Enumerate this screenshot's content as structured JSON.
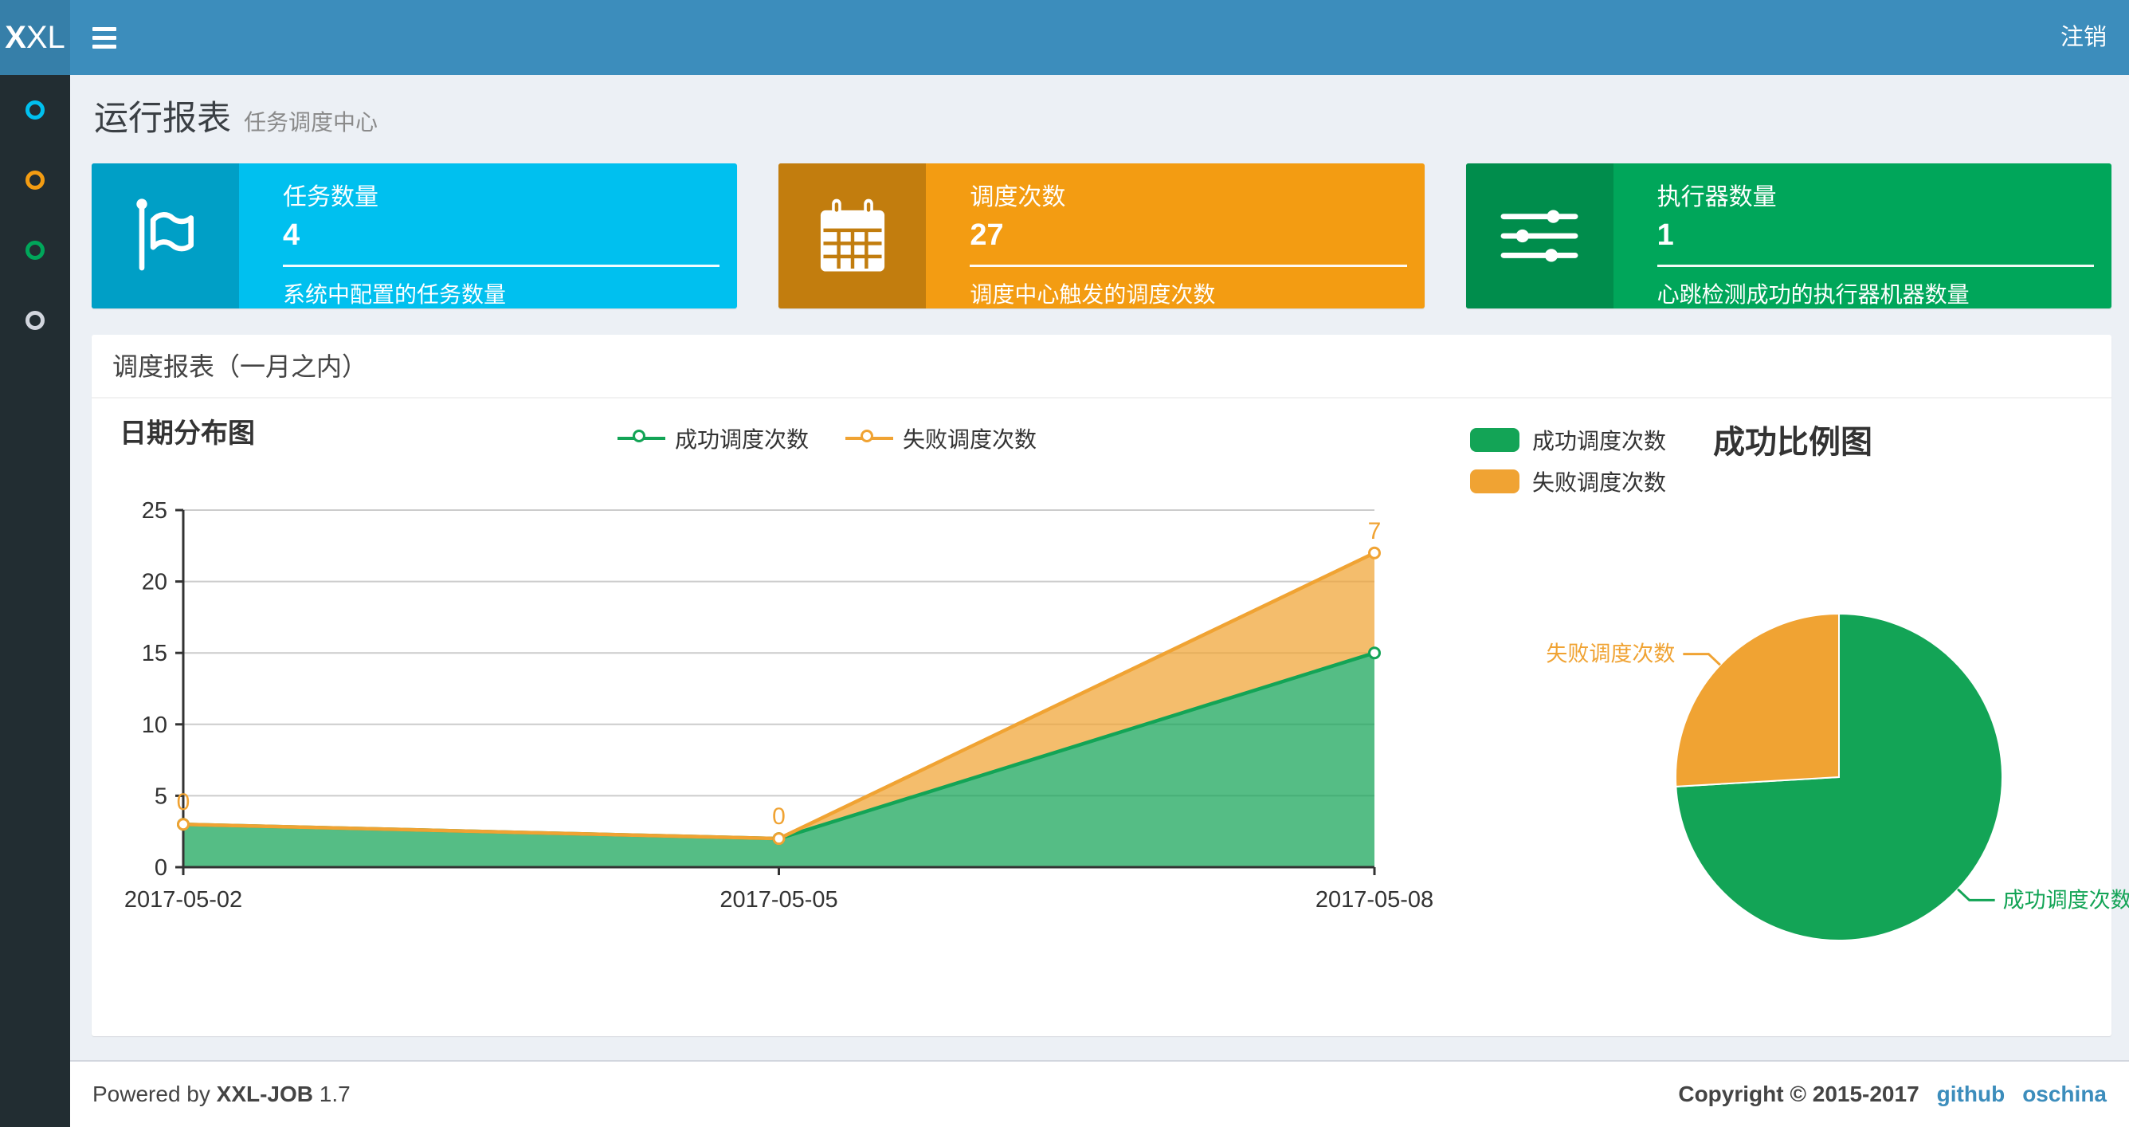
{
  "navbar": {
    "logo_bold": "X",
    "logo_rest": "XL",
    "logout": "注销"
  },
  "sidebar": {
    "items": [
      {
        "name": "menu-dashboard",
        "color": "#00c0ef"
      },
      {
        "name": "menu-jobs",
        "color": "#f39c12"
      },
      {
        "name": "menu-executors",
        "color": "#00a65a"
      },
      {
        "name": "menu-logs",
        "color": "#d2d6de"
      }
    ]
  },
  "page_header": {
    "title": "运行报表",
    "subtitle": "任务调度中心"
  },
  "stat_cards": [
    {
      "title": "任务数量",
      "value": "4",
      "description": "系统中配置的任务数量",
      "color": "#00c0ef",
      "icon_bg": "#009fc6",
      "icon": "flag"
    },
    {
      "title": "调度次数",
      "value": "27",
      "description": "调度中心触发的调度次数",
      "color": "#f39c12",
      "icon_bg": "#c27d0e",
      "icon": "calendar"
    },
    {
      "title": "执行器数量",
      "value": "1",
      "description": "心跳检测成功的执行器机器数量",
      "color": "#00a65a",
      "icon_bg": "#008d4c",
      "icon": "sliders"
    }
  ],
  "panel": {
    "title": "调度报表（一月之内）"
  },
  "chart_data": [
    {
      "type": "area",
      "title": "日期分布图",
      "stacked": true,
      "categories": [
        "2017-05-02",
        "2017-05-05",
        "2017-05-08"
      ],
      "series": [
        {
          "name": "成功调度次数",
          "values": [
            3,
            2,
            15
          ],
          "color": "#13a456"
        },
        {
          "name": "失败调度次数",
          "values": [
            0,
            0,
            7
          ],
          "color": "#f0a333"
        }
      ],
      "data_labels_series": "失败调度次数",
      "data_labels": [
        0,
        0,
        7
      ],
      "ylim": [
        0,
        25
      ],
      "ytick_interval": 5,
      "grid": true,
      "legend_position": "top-center"
    },
    {
      "type": "pie",
      "title": "成功比例图",
      "labels": [
        "成功调度次数",
        "失败调度次数"
      ],
      "values": [
        20,
        7
      ],
      "colors": [
        "#13a456",
        "#f0a333"
      ],
      "start_angle_deg": 90,
      "direction": "clockwise",
      "legend_position": "top-left"
    }
  ],
  "footer": {
    "powered_prefix": "Powered by",
    "product": "XXL-JOB",
    "version": "1.7",
    "copyright": "Copyright © 2015-2017",
    "links": [
      "github",
      "oschina"
    ]
  },
  "colors": {
    "navbar": "#3c8dbc",
    "navbar_logo": "#367fa9",
    "sidebar_bg": "#222d32",
    "content_bg": "#ecf0f5",
    "panel_bg": "#ffffff",
    "footer_border": "#d2d6de",
    "link": "#3c8dbc",
    "grid_line": "#cccccc",
    "axis": "#333333"
  }
}
